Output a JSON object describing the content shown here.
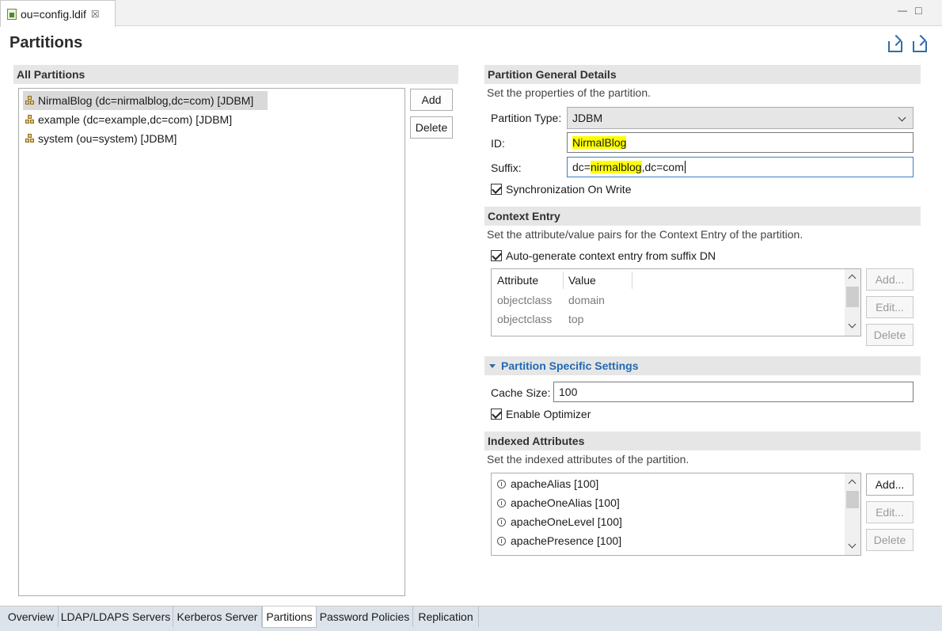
{
  "editor_tab": {
    "title": "ou=config.ldif",
    "close": "☒"
  },
  "window_controls": {
    "minimize": "—",
    "maximize": "□"
  },
  "page_title": "Partitions",
  "left": {
    "section_title": "All Partitions",
    "partitions": [
      {
        "label": "NirmalBlog (dc=nirmalblog,dc=com) [JDBM]",
        "selected": true
      },
      {
        "label": "example (dc=example,dc=com) [JDBM]",
        "selected": false
      },
      {
        "label": "system (ou=system) [JDBM]",
        "selected": false
      }
    ],
    "add_label": "Add",
    "delete_label": "Delete"
  },
  "general": {
    "section_title": "Partition General Details",
    "description": "Set the properties of the partition.",
    "type_label": "Partition Type:",
    "type_value": "JDBM",
    "id_label": "ID:",
    "id_value": "NirmalBlog",
    "suffix_label": "Suffix:",
    "suffix_prefix": "dc=",
    "suffix_highlight": "nirmalblog",
    "suffix_rest": ",dc=com",
    "sync_label": "Synchronization On Write",
    "sync_checked": true
  },
  "context": {
    "section_title": "Context Entry",
    "description": "Set the attribute/value pairs for the Context Entry of the partition.",
    "autogen_label": "Auto-generate context entry from suffix DN",
    "autogen_checked": true,
    "columns": [
      "Attribute",
      "Value"
    ],
    "rows": [
      {
        "attribute": "objectclass",
        "value": "domain"
      },
      {
        "attribute": "objectclass",
        "value": "top"
      }
    ],
    "add_label": "Add...",
    "edit_label": "Edit...",
    "delete_label": "Delete"
  },
  "specific": {
    "section_title": "Partition Specific Settings",
    "cache_label": "Cache Size:",
    "cache_value": "100",
    "optimizer_label": "Enable Optimizer",
    "optimizer_checked": true
  },
  "indexed": {
    "section_title": "Indexed Attributes",
    "description": "Set the indexed attributes of the partition.",
    "items": [
      "apacheAlias [100]",
      "apacheOneAlias [100]",
      "apacheOneLevel [100]",
      "apachePresence [100]"
    ],
    "add_label": "Add...",
    "edit_label": "Edit...",
    "delete_label": "Delete"
  },
  "bottom_tabs": [
    {
      "label": "Overview",
      "active": false
    },
    {
      "label": "LDAP/LDAPS Servers",
      "active": false
    },
    {
      "label": "Kerberos Server",
      "active": false
    },
    {
      "label": "Partitions",
      "active": true
    },
    {
      "label": "Password Policies",
      "active": false
    },
    {
      "label": "Replication",
      "active": false
    }
  ],
  "colors": {
    "highlight": "#ffff00",
    "accent": "#1f6ab5",
    "section_bg": "#e6e6e6"
  }
}
